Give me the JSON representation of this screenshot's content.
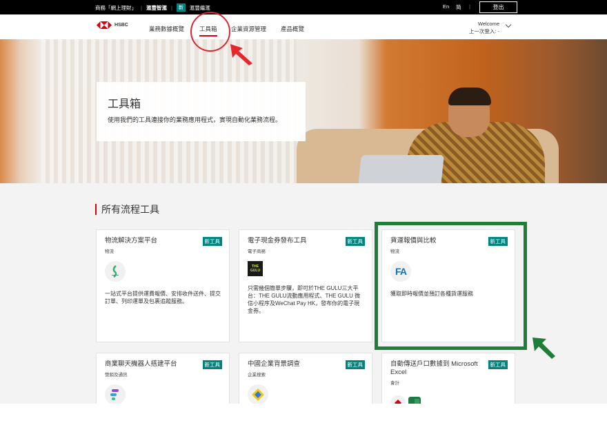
{
  "topbar": {
    "links": [
      "商務「網上理財」",
      "滙豐智滙",
      "新",
      "滙豐繼滙"
    ],
    "lang_en": "En",
    "lang_sc": "简",
    "logout": "登出"
  },
  "navbar": {
    "logo_text": "HSBC",
    "items": [
      "業務數據概覽",
      "工具箱",
      "企業資源管理",
      "產品概覽"
    ],
    "active_index": 1,
    "welcome": "Welcome",
    "last_login": "上一次登入: -"
  },
  "hero": {
    "title": "工具箱",
    "subtitle": "使用我們的工具連接你的業務應用程式，實現自動化業務流程。"
  },
  "section": {
    "title": "所有流程工具"
  },
  "cards": [
    {
      "title": "物流解決方案平台",
      "category": "物流",
      "badge": "新工具",
      "icon": "parcel-logo-icon",
      "desc": "一站式平台提供運費報價、安排收件送件、提交訂單、列印運單及包裹追蹤服務。"
    },
    {
      "title": "電子現金券發布工具",
      "category": "電子商務",
      "badge": "新工具",
      "icon": "the-gulu-logo-icon",
      "icon_text": "THE GULU",
      "desc": "只需幾個簡單步驟，即可於THE GULU三大平台：THE GULU流動應用程式、THE GULU 微信小程序及WeChat Pay HK，發布你的電子現金券。"
    },
    {
      "title": "貨運報價與比較",
      "category": "物流",
      "badge": "新工具",
      "icon": "fa-logo-icon",
      "icon_text": "FA",
      "desc": "獲取即時報價並預訂各種貨運服務"
    },
    {
      "title": "商業聊天機器人搭建平台",
      "category": "營銷及通訊",
      "badge": "新工具",
      "icon": "chatbot-logo-icon",
      "desc": ""
    },
    {
      "title": "中國企業背景調查",
      "category": "企業搜索",
      "badge": "新工具",
      "icon": "company-check-logo-icon",
      "icon_text": "E",
      "desc": ""
    },
    {
      "title": "自動傳送戶口數據到 Microsoft Excel",
      "category": "會計",
      "badge": "新工具",
      "icon": "hsbc-excel-logo-icon",
      "desc": ""
    }
  ],
  "colors": {
    "brand_red": "#db0011",
    "badge_teal": "#00847f",
    "annotation_red": "#d7282f",
    "annotation_green": "#1e7d36"
  }
}
